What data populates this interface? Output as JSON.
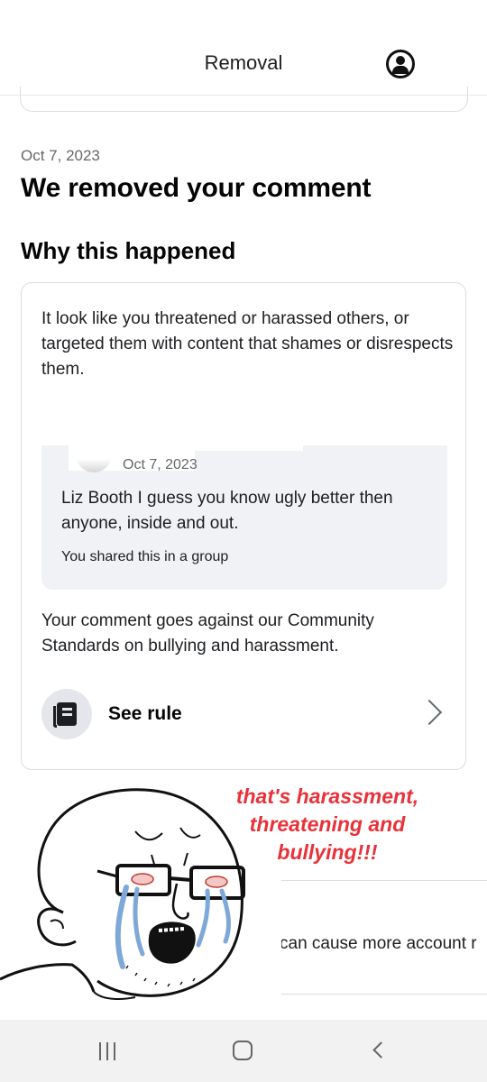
{
  "header": {
    "title": "Removal"
  },
  "main": {
    "date": "Oct 7, 2023",
    "heading": "We removed your comment",
    "subheading": "Why this happened",
    "card": {
      "explanation": "It look like you threatened or harassed others, or targeted them with content that shames or disrespects them.",
      "quote": {
        "date": "Oct 7, 2023",
        "text": "Liz Booth I guess you know ugly better then anyone, inside and out.",
        "shared": "You shared this in a group"
      },
      "standards": "Your comment goes against our Community Standards on bullying and harassment.",
      "see_rule": "See rule"
    },
    "cutoff_text": "can cause more account r"
  },
  "meme": {
    "caption": "that's harassment, threatening and bullying!!!"
  },
  "colors": {
    "caption": "#e8323a",
    "tears": "#7ea8d8",
    "secondary_text": "#65676b",
    "navbar": "#f2f2f2"
  },
  "icons": {
    "account": "account-icon",
    "rule": "rule-book-icon",
    "chevron": "chevron-right-icon",
    "nav_recents": "recents-icon",
    "nav_home": "home-icon",
    "nav_back": "back-icon"
  }
}
